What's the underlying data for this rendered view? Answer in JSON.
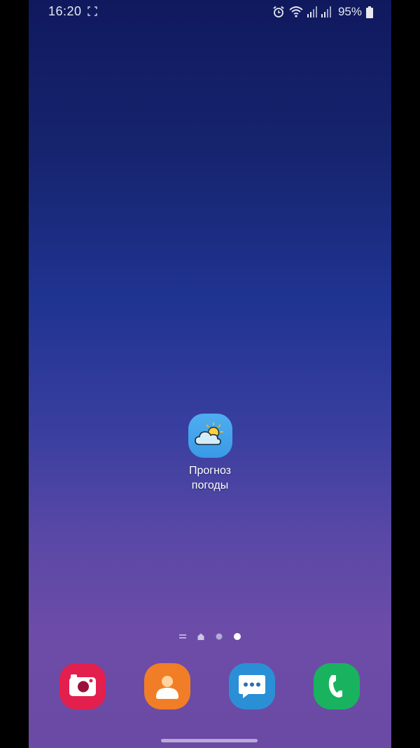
{
  "status_bar": {
    "time": "16:20",
    "battery_percent": "95%",
    "icons": [
      "screenshot-icon",
      "alarm-icon",
      "wifi-icon",
      "signal-icon",
      "signal-icon",
      "battery-icon"
    ]
  },
  "home_screen": {
    "apps": [
      {
        "name": "weather",
        "label_line1": "Прогноз",
        "label_line2": "погоды",
        "icon": "weather-icon",
        "color": "#3a9ae6"
      }
    ],
    "page_indicator": {
      "pages": [
        "apps-list",
        "home",
        "page-1",
        "page-2"
      ],
      "active_index": 3
    }
  },
  "dock": {
    "apps": [
      {
        "name": "camera",
        "icon": "camera-icon",
        "color": "#e21f4d"
      },
      {
        "name": "contacts",
        "icon": "contacts-icon",
        "color": "#f17e26"
      },
      {
        "name": "messages",
        "icon": "messages-icon",
        "color": "#2b8fd6"
      },
      {
        "name": "phone",
        "icon": "phone-icon",
        "color": "#19b35f"
      }
    ]
  },
  "colors": {
    "wallpaper_top": "#10195e",
    "wallpaper_bottom": "#6a4aa3"
  }
}
